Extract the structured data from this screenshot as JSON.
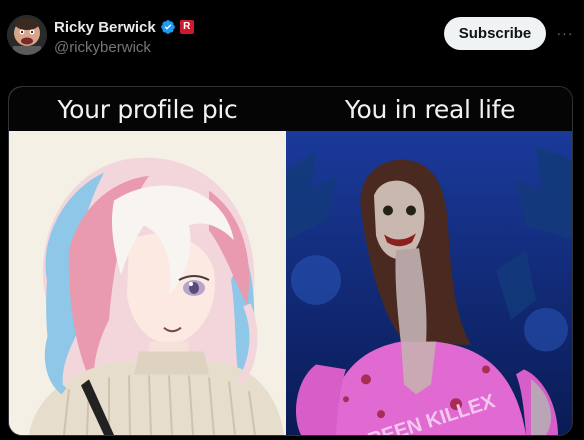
{
  "post": {
    "author_name": "Ricky Berwick",
    "handle": "@rickyberwick",
    "subscribe_label": "Subscribe",
    "more_label": "···",
    "verified_icon": "verified-badge-icon",
    "affiliate_icon": "affiliate-badge-icon",
    "affiliate_text": "R"
  },
  "meme": {
    "left_caption": "Your profile pic",
    "right_caption": "You in real life",
    "shirt_text": "GREEN KILLEX"
  },
  "colors": {
    "background": "#000000",
    "subscribe_bg": "#eff3f4",
    "verified_blue": "#1d9bf0",
    "affiliate_red": "#d0182f",
    "handle_gray": "#71767b"
  }
}
